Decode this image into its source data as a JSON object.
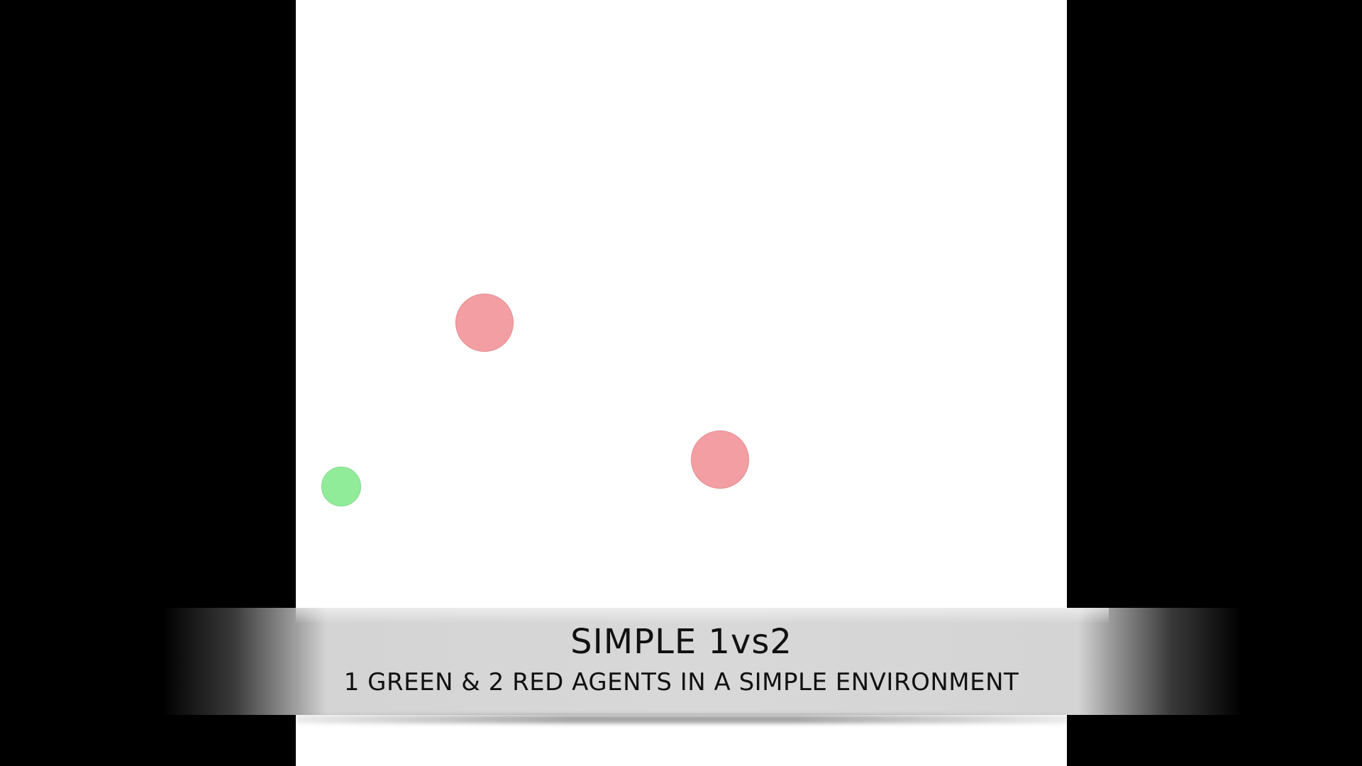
{
  "caption": {
    "title": "SIMPLE 1vs2",
    "subtitle": "1 GREEN & 2 RED AGENTS IN A SIMPLE ENVIRONMENT"
  },
  "agents": [
    {
      "team": "red",
      "color": "#f39ea3"
    },
    {
      "team": "red",
      "color": "#f39ea3"
    },
    {
      "team": "green",
      "color": "#91ec99"
    }
  ],
  "colors": {
    "background": "#000000",
    "arena": "#ffffff"
  }
}
